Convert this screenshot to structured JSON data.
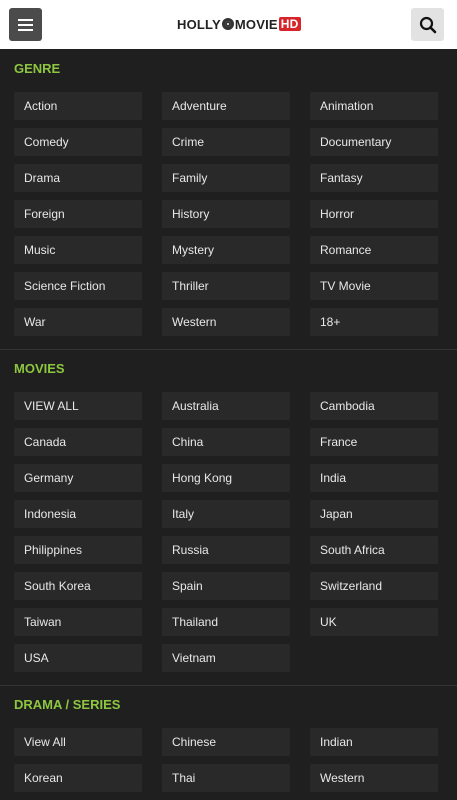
{
  "header": {
    "logo": {
      "part1": "HOLLY",
      "part2": "MOVIE",
      "part3": "HD"
    }
  },
  "genre": {
    "title": "GENRE",
    "items": [
      "Action",
      "Adventure",
      "Animation",
      "Comedy",
      "Crime",
      "Documentary",
      "Drama",
      "Family",
      "Fantasy",
      "Foreign",
      "History",
      "Horror",
      "Music",
      "Mystery",
      "Romance",
      "Science Fiction",
      "Thriller",
      "TV Movie",
      "War",
      "Western",
      "18+"
    ]
  },
  "movies": {
    "title": "MOVIES",
    "items": [
      "VIEW ALL",
      "Australia",
      "Cambodia",
      "Canada",
      "China",
      "France",
      "Germany",
      "Hong Kong",
      "India",
      "Indonesia",
      "Italy",
      "Japan",
      "Philippines",
      "Russia",
      "South Africa",
      "South Korea",
      "Spain",
      "Switzerland",
      "Taiwan",
      "Thailand",
      "UK",
      "USA",
      "Vietnam"
    ]
  },
  "drama": {
    "title": "DRAMA / SERIES",
    "items": [
      "View All",
      "Chinese",
      "Indian",
      "Korean",
      "Thai",
      "Western"
    ]
  }
}
